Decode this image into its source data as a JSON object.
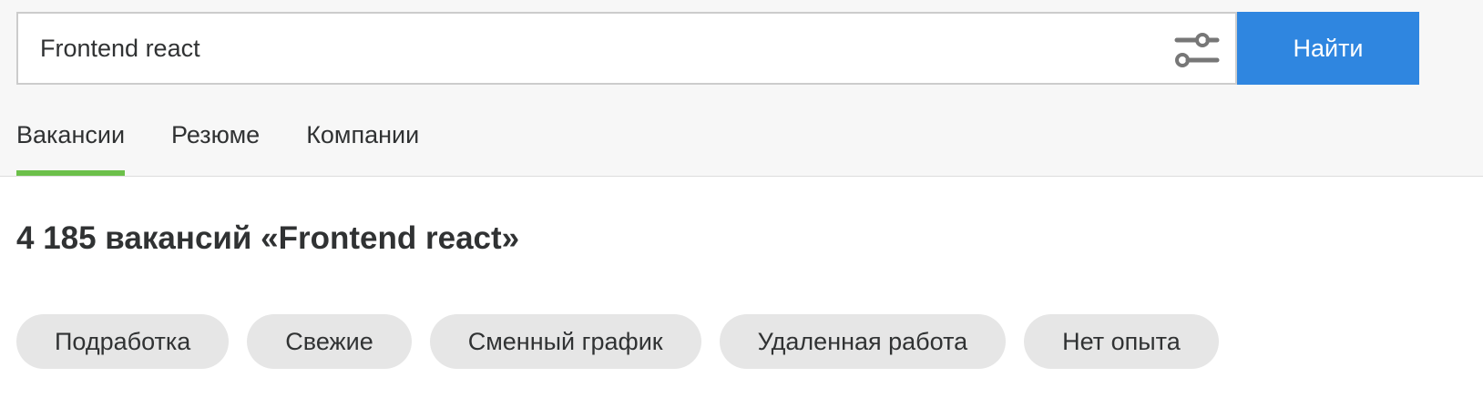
{
  "search": {
    "value": "Frontend react",
    "button_label": "Найти",
    "filter_icon": "sliders-icon"
  },
  "tabs": [
    {
      "label": "Вакансии",
      "active": true
    },
    {
      "label": "Резюме",
      "active": false
    },
    {
      "label": "Компании",
      "active": false
    }
  ],
  "results": {
    "title": "4 185 вакансий «Frontend react»"
  },
  "chips": [
    {
      "label": "Подработка"
    },
    {
      "label": "Свежие"
    },
    {
      "label": "Сменный график"
    },
    {
      "label": "Удаленная работа"
    },
    {
      "label": "Нет опыта"
    }
  ],
  "colors": {
    "accent_blue": "#2f86e0",
    "tab_underline_green": "#6cc04a",
    "chip_background": "#e6e6e6",
    "header_background": "#f7f7f7"
  }
}
